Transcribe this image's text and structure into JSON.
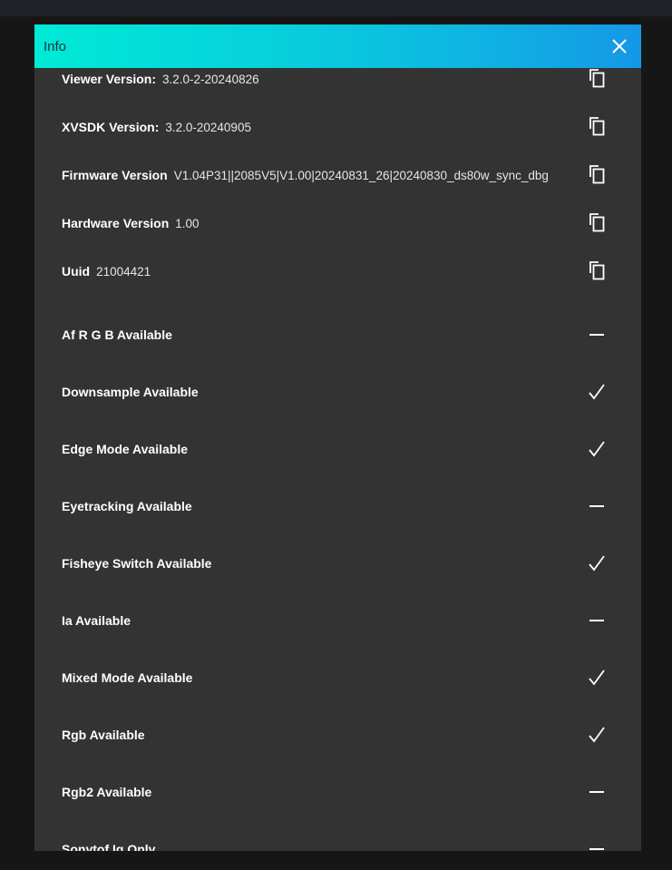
{
  "dialog": {
    "title": "Info",
    "info_rows": [
      {
        "label": "Viewer Version:",
        "value": "3.2.0-2-20240826"
      },
      {
        "label": "XVSDK Version:",
        "value": "3.2.0-20240905"
      },
      {
        "label": "Firmware Version",
        "value": "V1.04P31||2085V5|V1.00|20240831_26|20240830_ds80w_sync_dbg"
      },
      {
        "label": "Hardware Version",
        "value": "1.00"
      },
      {
        "label": "Uuid",
        "value": "21004421"
      }
    ],
    "feature_rows": [
      {
        "label": "Af R G B Available",
        "status": "unavailable"
      },
      {
        "label": "Downsample Available",
        "status": "available"
      },
      {
        "label": "Edge Mode Available",
        "status": "available"
      },
      {
        "label": "Eyetracking Available",
        "status": "unavailable"
      },
      {
        "label": "Fisheye Switch Available",
        "status": "available"
      },
      {
        "label": "Ia Available",
        "status": "unavailable"
      },
      {
        "label": "Mixed Mode Available",
        "status": "available"
      },
      {
        "label": "Rgb Available",
        "status": "available"
      },
      {
        "label": "Rgb2 Available",
        "status": "unavailable"
      },
      {
        "label": "Sonytof Iq Only",
        "status": "unavailable"
      }
    ]
  },
  "icons": {
    "close": "close-icon",
    "copy": "copy-icon",
    "available": "check-icon",
    "unavailable": "dash-icon"
  },
  "colors": {
    "header_start": "#00ead6",
    "header_end": "#1597e6",
    "dialog_bg": "#333333",
    "page_bg": "#161616"
  }
}
